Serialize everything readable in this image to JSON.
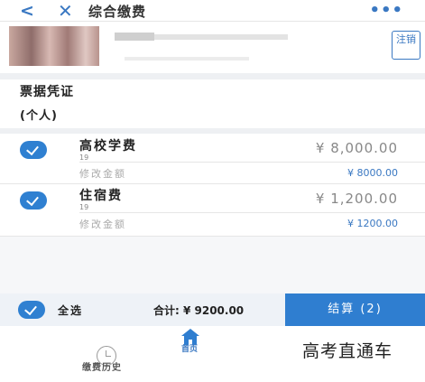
{
  "header": {
    "back_glyph": "<",
    "close_glyph": "✕",
    "title": "综合缴费",
    "more_glyph": "•••"
  },
  "user": {
    "logout_label": "注销"
  },
  "receipt": {
    "title": "票据凭证",
    "type": "(个人)"
  },
  "fees": [
    {
      "name": "高校学费",
      "code": "19",
      "amount": "¥ 8,000.00",
      "edit_label": "修改金额",
      "edit_amount": "¥ 8000.00",
      "checked": true
    },
    {
      "name": "住宿费",
      "code": "19",
      "amount": "¥ 1,200.00",
      "edit_label": "修改金额",
      "edit_amount": "¥ 1200.00",
      "checked": true
    }
  ],
  "summary": {
    "select_all_label": "全选",
    "total_text": "合计: ¥ 9200.00",
    "checkout_label": "结算 (2)"
  },
  "tabbar": {
    "home_label": "首页",
    "history_label": "缴费历史"
  },
  "watermark": "高考直通车",
  "colors": {
    "accent": "#2f7ed0",
    "link": "#3a78c2",
    "section_bg": "#eef0f3"
  }
}
